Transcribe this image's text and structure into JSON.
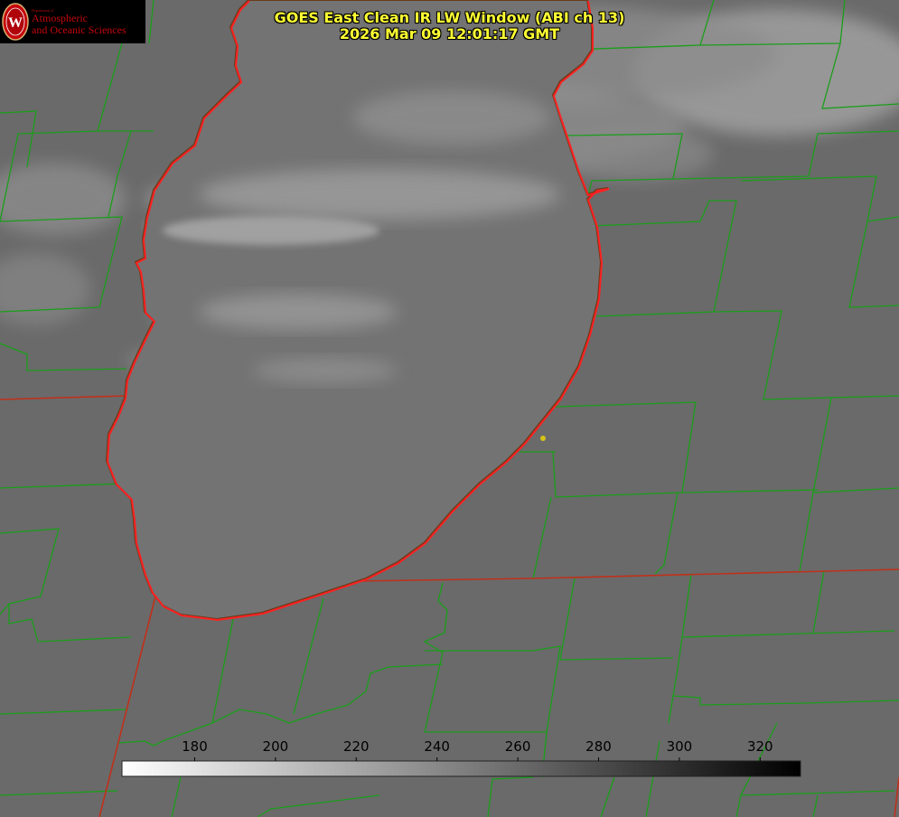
{
  "title": {
    "line1": "GOES East Clean IR LW Window (ABI ch 13)",
    "line2": "2026 Mar 09 12:01:17 GMT"
  },
  "logo": {
    "department": "Department of",
    "line1": "Atmospheric",
    "line2": "and Oceanic Sciences",
    "seal_letter": "W"
  },
  "colorbar": {
    "min": 162,
    "max": 330,
    "ticks": [
      180,
      200,
      220,
      240,
      260,
      280,
      300,
      320
    ],
    "gradient": [
      "#ffffff",
      "#000000"
    ]
  },
  "colors": {
    "background_gray": "#6f6f6f",
    "county_lines": "#1a9e1a",
    "state_and_lake_lines": "#ff2020",
    "title_text": "#ffff33",
    "logo_red": "#c5050c",
    "station_marker": "#d4c21a"
  }
}
